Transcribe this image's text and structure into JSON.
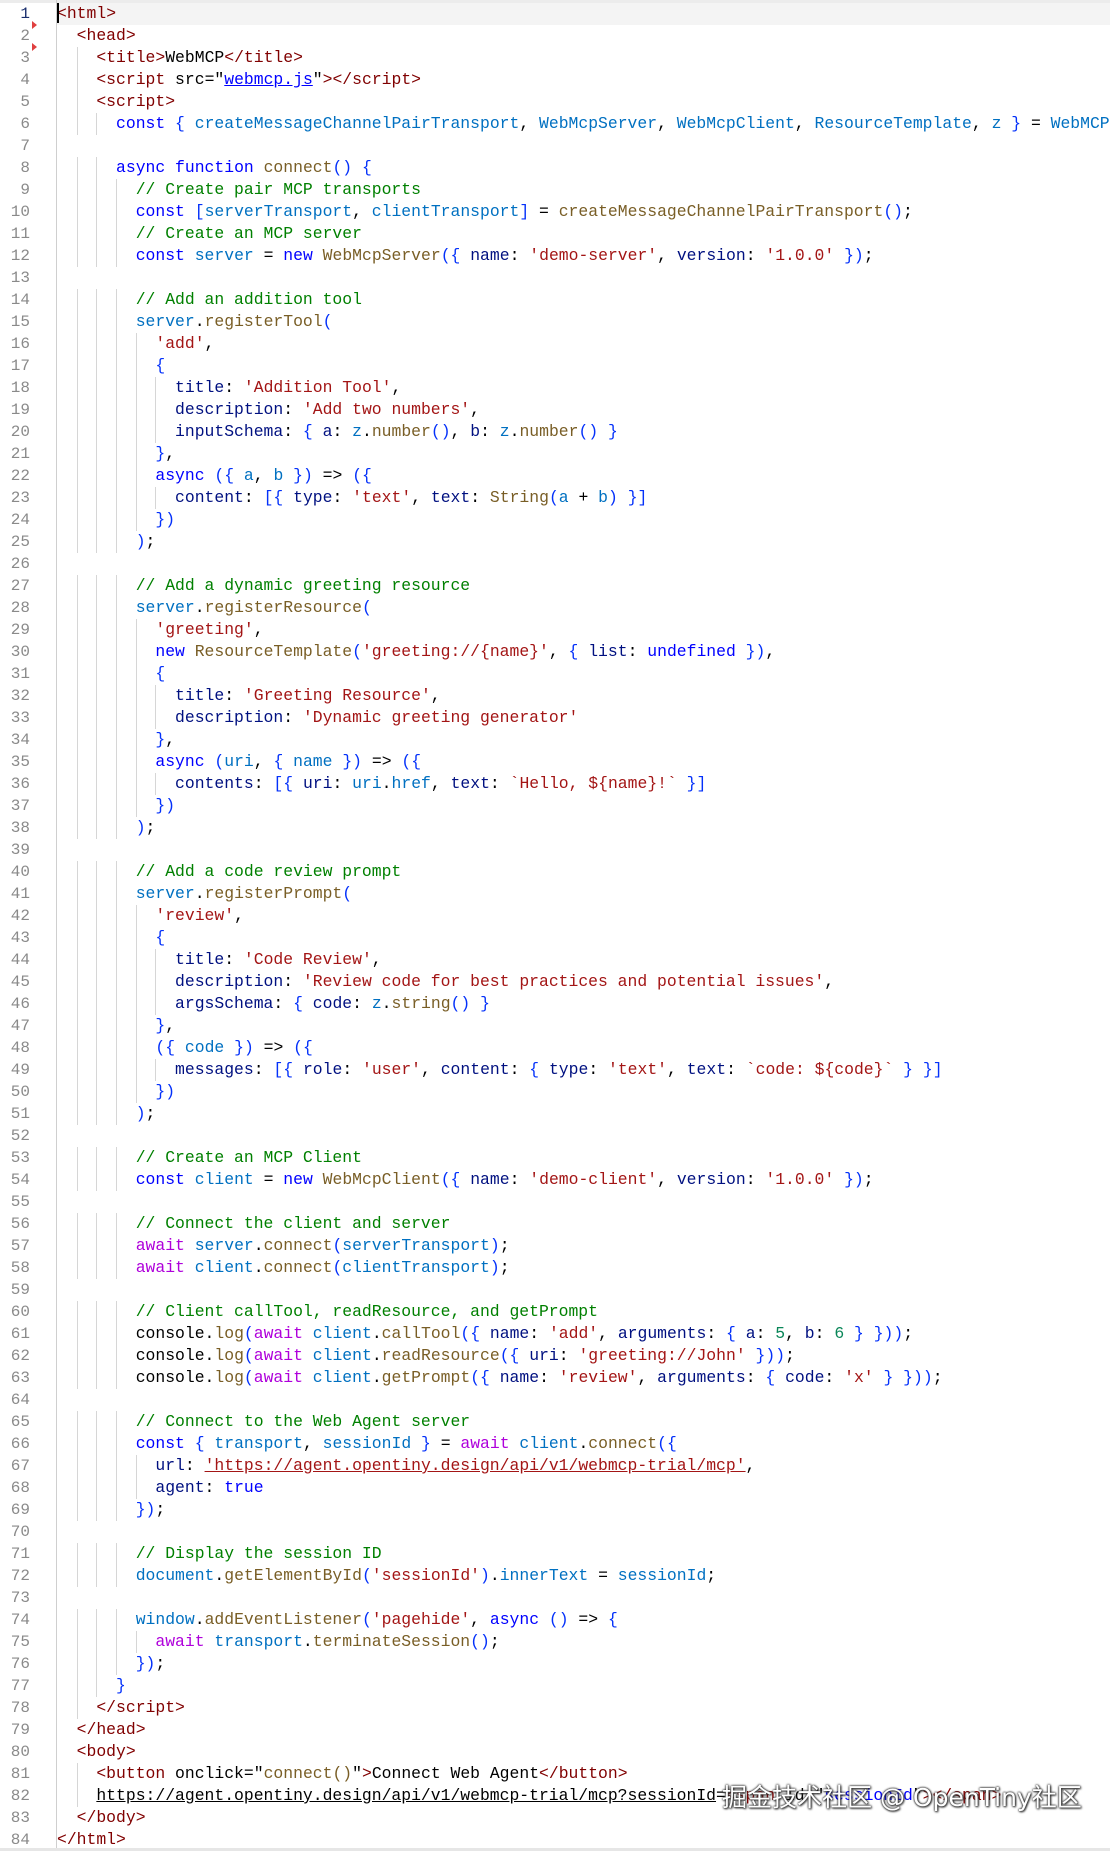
{
  "editor": {
    "lines": [
      "<html>",
      "  <head>",
      "    <title>WebMCP</title>",
      "    <script src=\"webmcp.js\"></script>",
      "    <script>",
      "      const { createMessageChannelPairTransport, WebMcpServer, WebMcpClient, ResourceTemplate, z } = WebMCP;",
      "",
      "      async function connect() {",
      "        // Create pair MCP transports",
      "        const [serverTransport, clientTransport] = createMessageChannelPairTransport();",
      "        // Create an MCP server",
      "        const server = new WebMcpServer({ name: 'demo-server', version: '1.0.0' });",
      "",
      "        // Add an addition tool",
      "        server.registerTool(",
      "          'add',",
      "          {",
      "            title: 'Addition Tool',",
      "            description: 'Add two numbers',",
      "            inputSchema: { a: z.number(), b: z.number() }",
      "          },",
      "          async ({ a, b }) => ({",
      "            content: [{ type: 'text', text: String(a + b) }]",
      "          })",
      "        );",
      "",
      "        // Add a dynamic greeting resource",
      "        server.registerResource(",
      "          'greeting',",
      "          new ResourceTemplate('greeting://{name}', { list: undefined }),",
      "          {",
      "            title: 'Greeting Resource',",
      "            description: 'Dynamic greeting generator'",
      "          },",
      "          async (uri, { name }) => ({",
      "            contents: [{ uri: uri.href, text: `Hello, ${name}!` }]",
      "          })",
      "        );",
      "",
      "        // Add a code review prompt",
      "        server.registerPrompt(",
      "          'review',",
      "          {",
      "            title: 'Code Review',",
      "            description: 'Review code for best practices and potential issues',",
      "            argsSchema: { code: z.string() }",
      "          },",
      "          ({ code }) => ({",
      "            messages: [{ role: 'user', content: { type: 'text', text: `code: ${code}` } }]",
      "          })",
      "        );",
      "",
      "        // Create an MCP Client",
      "        const client = new WebMcpClient({ name: 'demo-client', version: '1.0.0' });",
      "",
      "        // Connect the client and server",
      "        await server.connect(serverTransport);",
      "        await client.connect(clientTransport);",
      "",
      "        // Client callTool, readResource, and getPrompt",
      "        console.log(await client.callTool({ name: 'add', arguments: { a: 5, b: 6 } }));",
      "        console.log(await client.readResource({ uri: 'greeting://John' }));",
      "        console.log(await client.getPrompt({ name: 'review', arguments: { code: 'x' } }));",
      "",
      "        // Connect to the Web Agent server",
      "        const { transport, sessionId } = await client.connect({",
      "          url: 'https://agent.opentiny.design/api/v1/webmcp-trial/mcp',",
      "          agent: true",
      "        });",
      "",
      "        // Display the session ID",
      "        document.getElementById('sessionId').innerText = sessionId;",
      "",
      "        window.addEventListener('pagehide', async () => {",
      "          await transport.terminateSession();",
      "        });",
      "      }",
      "    </script>",
      "  </head>",
      "  <body>",
      "    <button onclick=\"connect()\">Connect Web Agent</button>",
      "    https://agent.opentiny.design/api/v1/webmcp-trial/mcp?sessionId=<span id=\"sessionId\"></span>",
      "  </body>",
      "</html>"
    ]
  },
  "watermark": "掘金技术社区 @ OpenTiny社区"
}
